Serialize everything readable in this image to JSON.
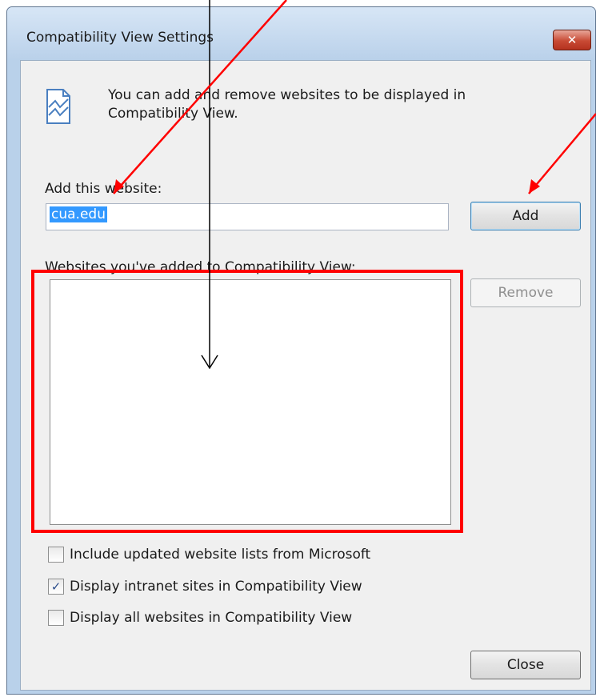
{
  "window": {
    "title": "Compatibility View Settings",
    "close_glyph": "✕"
  },
  "info": {
    "icon": "compatibility-view-icon",
    "line1": "You can add and remove websites to be displayed in",
    "line2": "Compatibility View."
  },
  "add_section": {
    "label": "Add this website:",
    "input_value": "cua.edu",
    "add_button": "Add"
  },
  "list_section": {
    "label": "Websites you've added to Compatibility View:",
    "items": [],
    "remove_button": "Remove"
  },
  "options": [
    {
      "label": "Include updated website lists from Microsoft",
      "checked": false,
      "check_mark": ""
    },
    {
      "label": "Display intranet sites in Compatibility View",
      "checked": true,
      "check_mark": "✓"
    },
    {
      "label": "Display all websites in Compatibility View",
      "checked": false,
      "check_mark": ""
    }
  ],
  "footer": {
    "close_button": "Close"
  },
  "annotation_colors": {
    "red": "#ff0000",
    "black": "#000000"
  }
}
